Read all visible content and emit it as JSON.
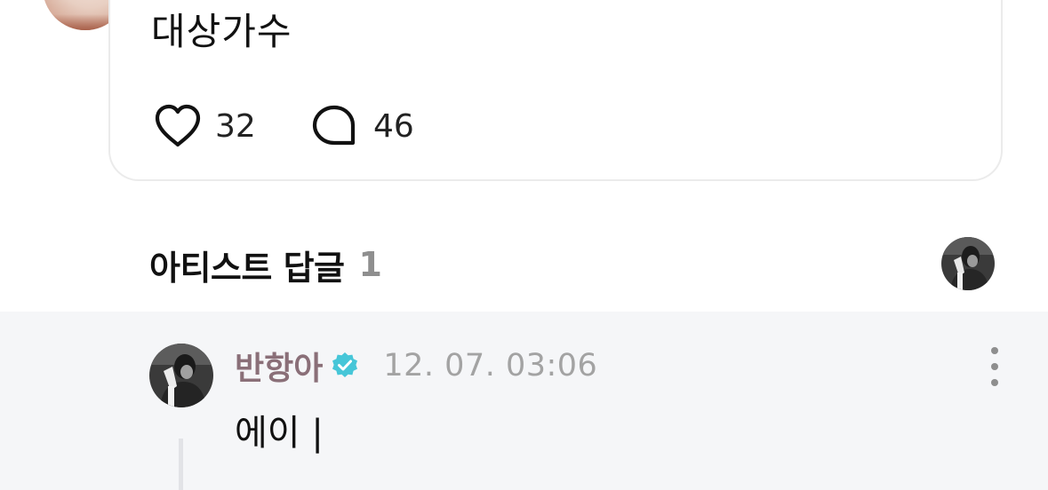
{
  "post": {
    "text": "대상가수",
    "like_count": "32",
    "comment_count": "46"
  },
  "artist_replies": {
    "title": "아티스트 답글",
    "count": "1"
  },
  "reply": {
    "author": "반항아",
    "timestamp": "12. 07. 03:06",
    "text": "에이 |",
    "verified_color": "#46c6d8"
  },
  "icons": {
    "like": "heart-icon",
    "comment": "comment-bubble-icon",
    "verified": "verified-badge-icon",
    "more": "more-vertical-icon"
  }
}
